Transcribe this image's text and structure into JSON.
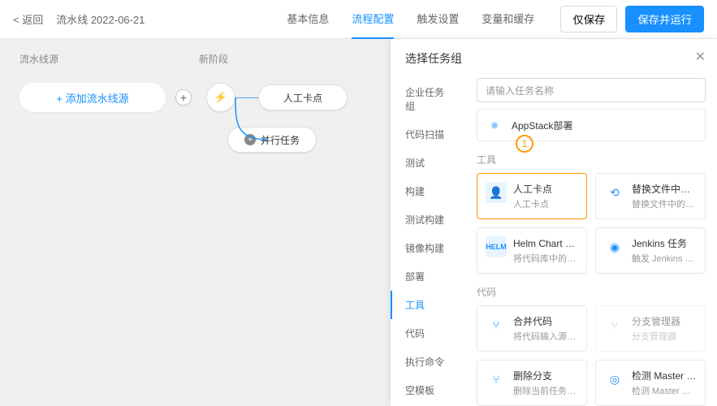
{
  "header": {
    "back": "< 返回",
    "title": "流水线 2022-06-21",
    "tabs": [
      "基本信息",
      "流程配置",
      "触发设置",
      "变量和缓存"
    ],
    "activeTab": 1,
    "saveOnly": "仅保存",
    "saveRun": "保存并运行"
  },
  "canvas": {
    "col1": "流水线源",
    "col2": "新阶段",
    "addSource": "+ 添加流水线源",
    "node1": "人工卡点",
    "node2": "并行任务",
    "flash": "⚡"
  },
  "panel": {
    "title": "选择任务组",
    "searchPlaceholder": "请输入任务名称",
    "sidebar": [
      "企业任务组",
      "代码扫描",
      "测试",
      "构建",
      "测试构建",
      "镜像构建",
      "部署",
      "工具",
      "代码",
      "执行命令",
      "空模板"
    ],
    "activeSidebar": 7,
    "topCard": "AppStack部署",
    "sectionTool": "工具",
    "sectionCode": "代码",
    "badge": "1",
    "cards": {
      "manual": {
        "t": "人工卡点",
        "s": "人工卡点"
      },
      "replace": {
        "t": "替换文件中的环...",
        "s": "替换文件中的环境..."
      },
      "helm": {
        "t": "Helm Chart 上...",
        "s": "将代码库中的 Hel..."
      },
      "jenkins": {
        "t": "Jenkins 任务",
        "s": "触发 Jenkins 任务"
      },
      "merge": {
        "t": "合并代码",
        "s": "将代码输入源中指..."
      },
      "branch": {
        "t": "分支管理器",
        "s": "分支管理器"
      },
      "delete": {
        "t": "删除分支",
        "s": "删除当前任务执行..."
      },
      "detect": {
        "t": "检测 Master 分...",
        "s": "检测 Master 分支..."
      }
    }
  }
}
